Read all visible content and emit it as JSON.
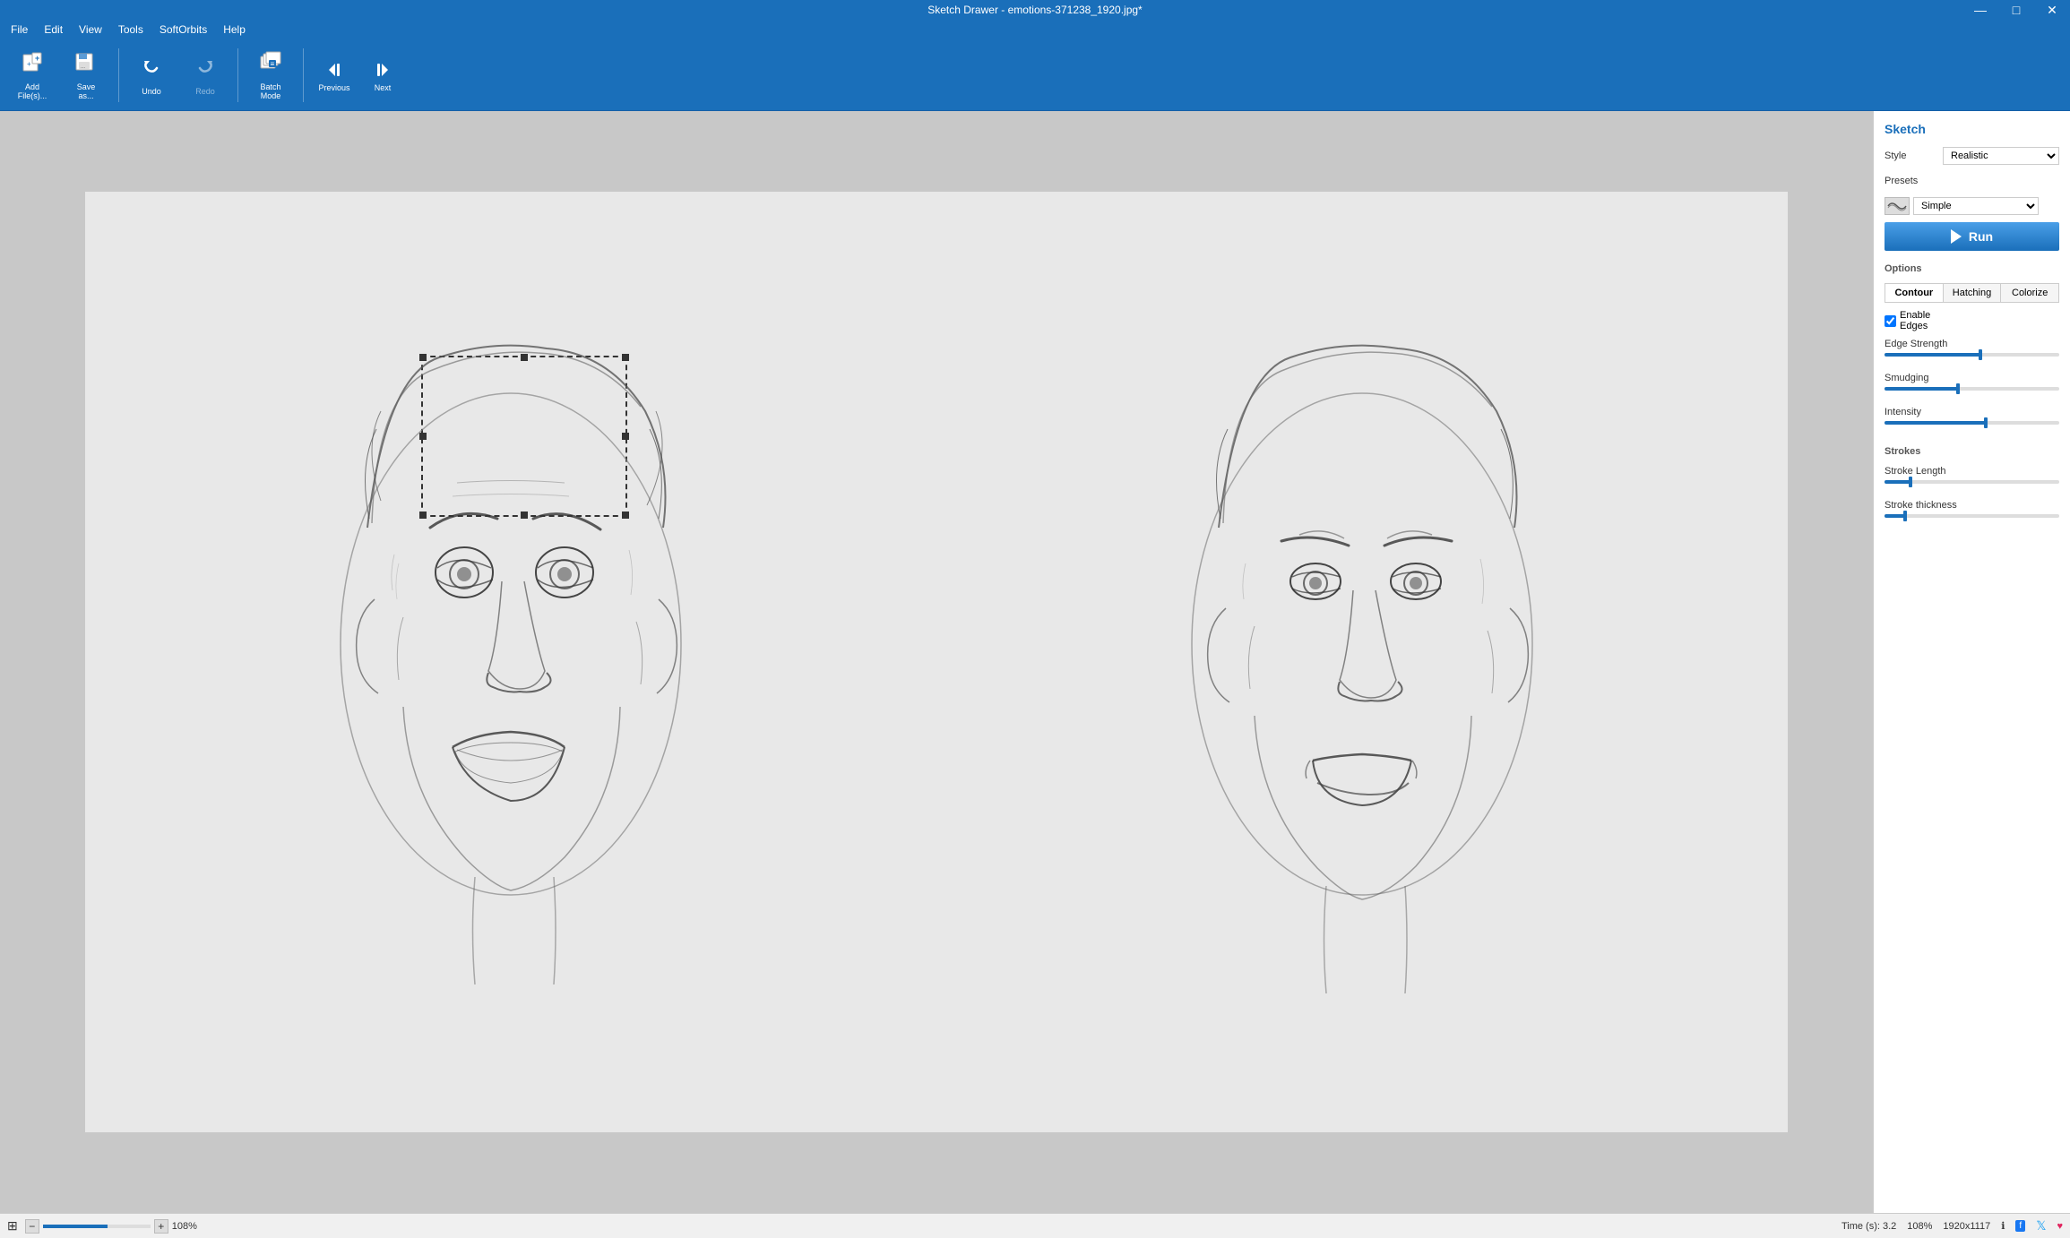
{
  "titleBar": {
    "title": "Sketch Drawer - emotions-371238_1920.jpg*",
    "minBtn": "—",
    "maxBtn": "□",
    "closeBtn": "✕"
  },
  "menuBar": {
    "items": [
      "File",
      "Edit",
      "View",
      "Tools",
      "SoftOrbits",
      "Help"
    ]
  },
  "toolbar": {
    "addFilesLabel": "Add\nFile(s)...",
    "saveAsLabel": "Save\nas...",
    "undoLabel": "Undo",
    "batchModeLabel": "Batch\nMode",
    "previousLabel": "Previous",
    "nextLabel": "Next"
  },
  "panel": {
    "title": "Sketch",
    "styleLabel": "Style",
    "styleValue": "Realistic",
    "presetsLabel": "Presets",
    "presetsValue": "Simple",
    "runLabel": "Run",
    "optionsLabel": "Options",
    "tabs": [
      "Contour",
      "Hatching",
      "Colorize"
    ],
    "enableEdgesLabel": "Enable\nEdges",
    "edgeStrengthLabel": "Edge Strength",
    "edgeStrengthValue": 55,
    "smudgingLabel": "Smudging",
    "smudgingValue": 42,
    "intensityLabel": "Intensity",
    "intensityValue": 58,
    "strokesLabel": "Strokes",
    "strokeLengthLabel": "Stroke Length",
    "strokeLengthValue": 15,
    "strokeThicknessLabel": "Stroke thickness",
    "strokeThicknessValue": 12
  },
  "statusBar": {
    "timeLabel": "Time (s): 3.2",
    "zoomLabel": "108%",
    "resolutionLabel": "1920x1117",
    "infoIcon": "ℹ",
    "facebookIcon": "f",
    "twitterIcon": "t",
    "heartIcon": "♥"
  }
}
